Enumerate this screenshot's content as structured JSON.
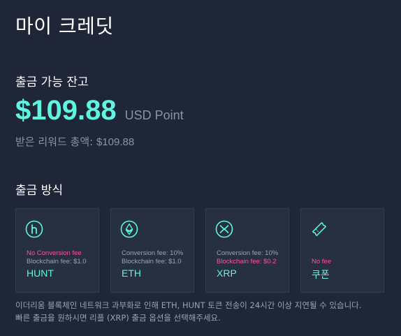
{
  "page_title": "마이 크레딧",
  "balance": {
    "label": "출금 가능 잔고",
    "amount": "$109.88",
    "unit": "USD Point",
    "total_label": "받은 리워드 총액: ",
    "total_value": "$109.88"
  },
  "withdraw": {
    "label": "출금 방식",
    "methods": [
      {
        "name": "HUNT",
        "fee_line1": "No Conversion fee",
        "fee_line2": "Blockchain fee: $1.0",
        "icon": "hunt-icon"
      },
      {
        "name": "ETH",
        "fee_line1": "Conversion fee: 10%",
        "fee_line2": "Blockchain fee: $1.0",
        "icon": "ethereum-icon"
      },
      {
        "name": "XRP",
        "fee_line1": "Conversion fee: 10%",
        "fee_line2": "Blockchain fee: $0.2",
        "icon": "xrp-icon"
      },
      {
        "name": "쿠폰",
        "fee_line1": "",
        "fee_line2": "No fee",
        "icon": "coupon-icon"
      }
    ]
  },
  "notice": {
    "line1": "이더리움 블록체인 네트워크 과부화로 인해 ETH, HUNT 토큰 전송이 24시간 이상 지연될 수 있습니다.",
    "line2": "빠른 출금을 원하시면 리플 (XRP) 출금 옵션을 선택해주세요."
  },
  "colors": {
    "background": "#1e2638",
    "accent": "#5ff5e0",
    "highlight": "#ff4fa6",
    "card": "#27303f"
  }
}
